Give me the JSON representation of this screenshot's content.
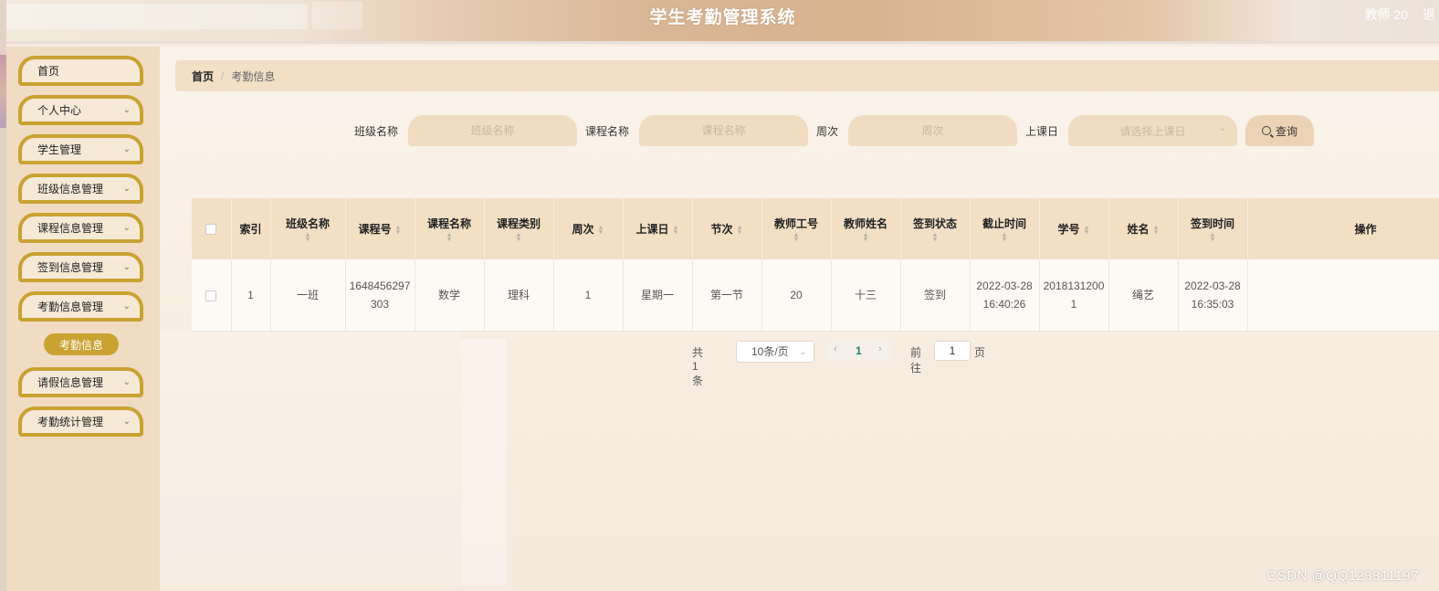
{
  "header": {
    "title": "学生考勤管理系统",
    "user": "教师 20",
    "user_extra": "退"
  },
  "sidebar": {
    "items": [
      {
        "label": "首页",
        "has_chevron": false
      },
      {
        "label": "个人中心",
        "has_chevron": true
      },
      {
        "label": "学生管理",
        "has_chevron": true
      },
      {
        "label": "班级信息管理",
        "has_chevron": true
      },
      {
        "label": "课程信息管理",
        "has_chevron": true
      },
      {
        "label": "签到信息管理",
        "has_chevron": true
      },
      {
        "label": "考勤信息管理",
        "has_chevron": true
      },
      {
        "label": "请假信息管理",
        "has_chevron": true
      },
      {
        "label": "考勤统计管理",
        "has_chevron": true
      }
    ],
    "subitem": "考勤信息"
  },
  "breadcrumb": {
    "home": "首页",
    "separator": "/",
    "current": "考勤信息"
  },
  "search": {
    "class_label": "班级名称",
    "class_placeholder": "班级名称",
    "course_label": "课程名称",
    "course_placeholder": "课程名称",
    "week_label": "周次",
    "week_placeholder": "周次",
    "day_label": "上课日",
    "day_placeholder": "请选择上课日",
    "query_label": "查询"
  },
  "table": {
    "columns": [
      "索引",
      "班级名称",
      "课程号",
      "课程名称",
      "课程类别",
      "周次",
      "上课日",
      "节次",
      "教师工号",
      "教师姓名",
      "签到状态",
      "截止时间",
      "学号",
      "姓名",
      "签到时间",
      "操作"
    ],
    "rows": [
      [
        "1",
        "一班",
        "1648456297303",
        "数学",
        "理科",
        "1",
        "星期一",
        "第一节",
        "20",
        "十三",
        "签到",
        "2022-03-28 16:40:26",
        "20181312001",
        "绳艺",
        "2022-03-28 16:35:03",
        ""
      ]
    ]
  },
  "pagination": {
    "total": "共 1 条",
    "page_size": "10条/页",
    "current_page": "1",
    "goto_label": "前往",
    "goto_value": "1",
    "page_suffix": "页"
  },
  "watermark": "CSDN @QQ123311197"
}
